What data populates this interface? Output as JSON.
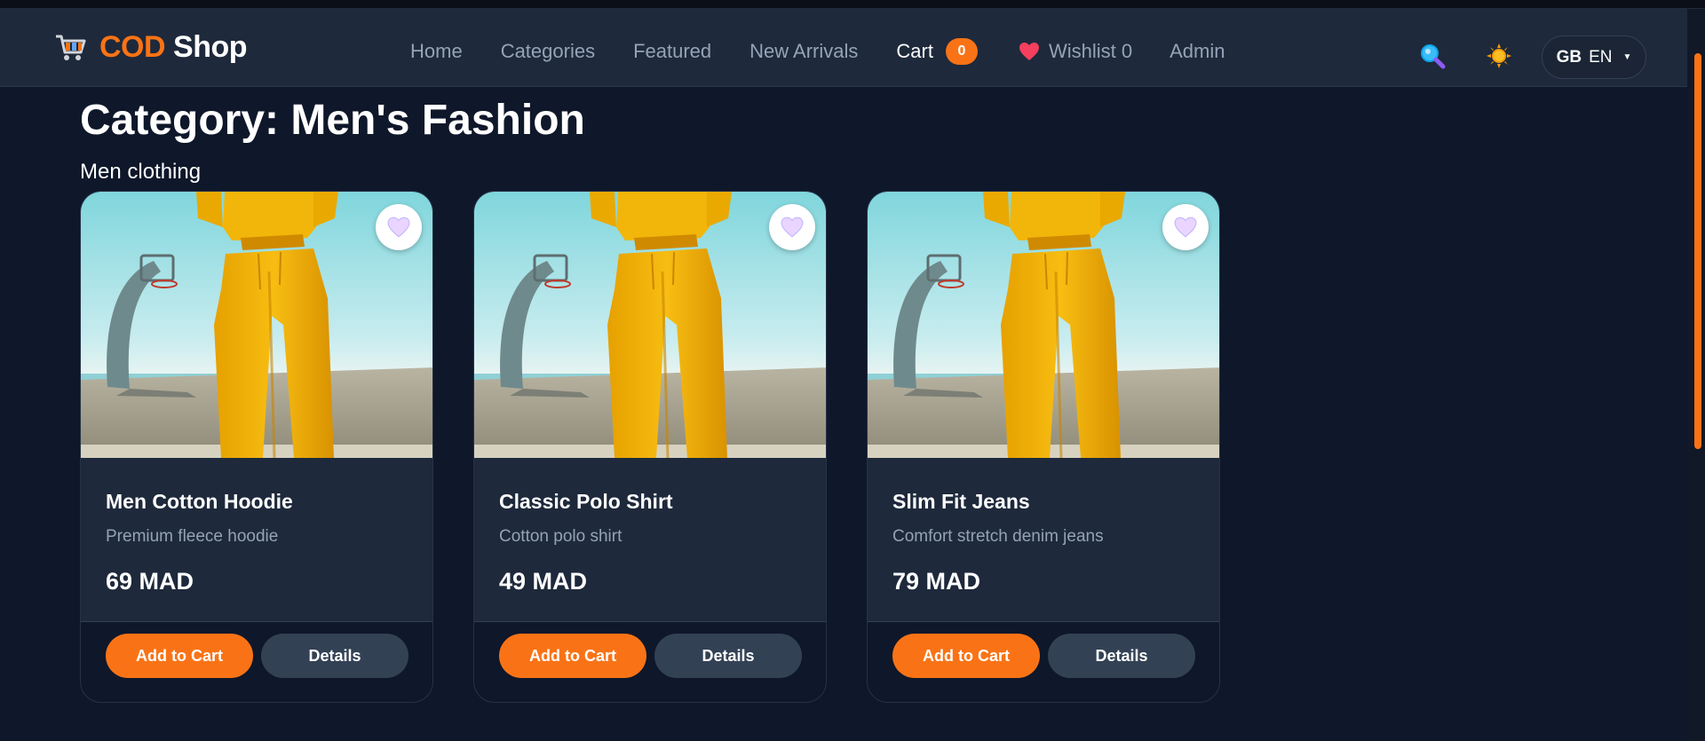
{
  "brand": {
    "cod": "COD",
    "shop": "Shop",
    "icon": "shopping-cart-icon"
  },
  "nav": {
    "home": "Home",
    "categories": "Categories",
    "featured": "Featured",
    "new_arrivals": "New Arrivals",
    "cart": "Cart",
    "cart_count": "0",
    "wishlist": "Wishlist 0",
    "admin": "Admin",
    "search_icon": "search-icon",
    "theme_icon": "sun-icon",
    "lang_flag": "GB",
    "lang_code": "EN"
  },
  "page": {
    "title": "Category: Men's Fashion",
    "subtitle": "Men clothing"
  },
  "products": [
    {
      "name": "Men Cotton Hoodie",
      "description": "Premium fleece hoodie",
      "price": "69 MAD",
      "add_label": "Add to Cart",
      "details_label": "Details"
    },
    {
      "name": "Classic Polo Shirt",
      "description": "Cotton polo shirt",
      "price": "49 MAD",
      "add_label": "Add to Cart",
      "details_label": "Details"
    },
    {
      "name": "Slim Fit Jeans",
      "description": "Comfort stretch denim jeans",
      "price": "79 MAD",
      "add_label": "Add to Cart",
      "details_label": "Details"
    }
  ],
  "colors": {
    "background": "#0f172a",
    "navbar": "#1e293b",
    "accent": "#f97316",
    "muted_text": "#94a3b8",
    "secondary_button": "#334155"
  }
}
